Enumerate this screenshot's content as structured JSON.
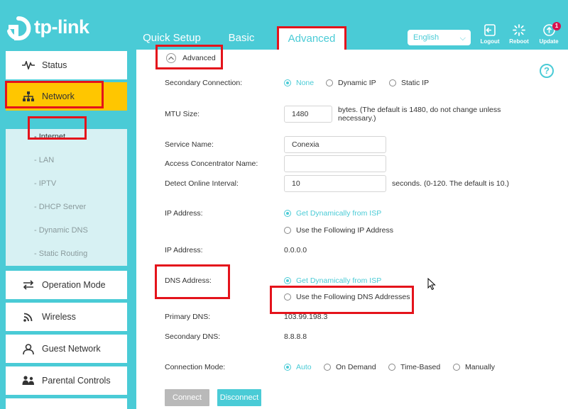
{
  "brand": {
    "logo_text": "tp-link"
  },
  "nav": {
    "quick_setup": "Quick Setup",
    "basic": "Basic",
    "advanced": "Advanced"
  },
  "language": {
    "selected": "English"
  },
  "top_actions": {
    "logout": "Logout",
    "reboot": "Reboot",
    "update": "Update",
    "update_badge": "1"
  },
  "sidebar": {
    "status": "Status",
    "network": "Network",
    "sub": [
      "Internet",
      "LAN",
      "IPTV",
      "DHCP Server",
      "Dynamic DNS",
      "Static Routing"
    ],
    "operation_mode": "Operation Mode",
    "wireless": "Wireless",
    "guest_network": "Guest Network",
    "parental_controls": "Parental Controls"
  },
  "form": {
    "advanced_toggle": "Advanced",
    "secondary_connection": {
      "label": "Secondary Connection:",
      "options": [
        "None",
        "Dynamic IP",
        "Static IP"
      ],
      "selected": "None"
    },
    "mtu": {
      "label": "MTU Size:",
      "value": "1480",
      "hint_line1": "bytes. (The default is 1480, do not change unless",
      "hint_line2": "necessary.)"
    },
    "service_name": {
      "label": "Service Name:",
      "value": "Conexia"
    },
    "access_concentrator": {
      "label": "Access Concentrator Name:",
      "value": ""
    },
    "detect_interval": {
      "label": "Detect Online Interval:",
      "value": "10",
      "hint": "seconds. (0-120. The default is 10.)"
    },
    "ip_mode": {
      "label": "IP Address:",
      "opt_dynamic": "Get Dynamically from ISP",
      "opt_static": "Use the Following IP Address",
      "selected": "Get Dynamically from ISP"
    },
    "ip_address": {
      "label": "IP Address:",
      "value": "0.0.0.0"
    },
    "dns_mode": {
      "label": "DNS Address:",
      "opt_dynamic": "Get Dynamically from ISP",
      "opt_static": "Use the Following DNS Addresses",
      "selected": "Get Dynamically from ISP"
    },
    "primary_dns": {
      "label": "Primary DNS:",
      "value": "103.99.198.3"
    },
    "secondary_dns": {
      "label": "Secondary DNS:",
      "value": "8.8.8.8"
    },
    "connection_mode": {
      "label": "Connection Mode:",
      "options": [
        "Auto",
        "On Demand",
        "Time-Based",
        "Manually"
      ],
      "selected": "Auto"
    },
    "connect_button": "Connect",
    "disconnect_button": "Disconnect"
  },
  "help": {
    "glyph": "?"
  },
  "colors": {
    "accent": "#4acbd6",
    "active_menu": "#ffc600",
    "highlight_box": "#e4131b",
    "disabled_button": "#b9b9b9"
  }
}
